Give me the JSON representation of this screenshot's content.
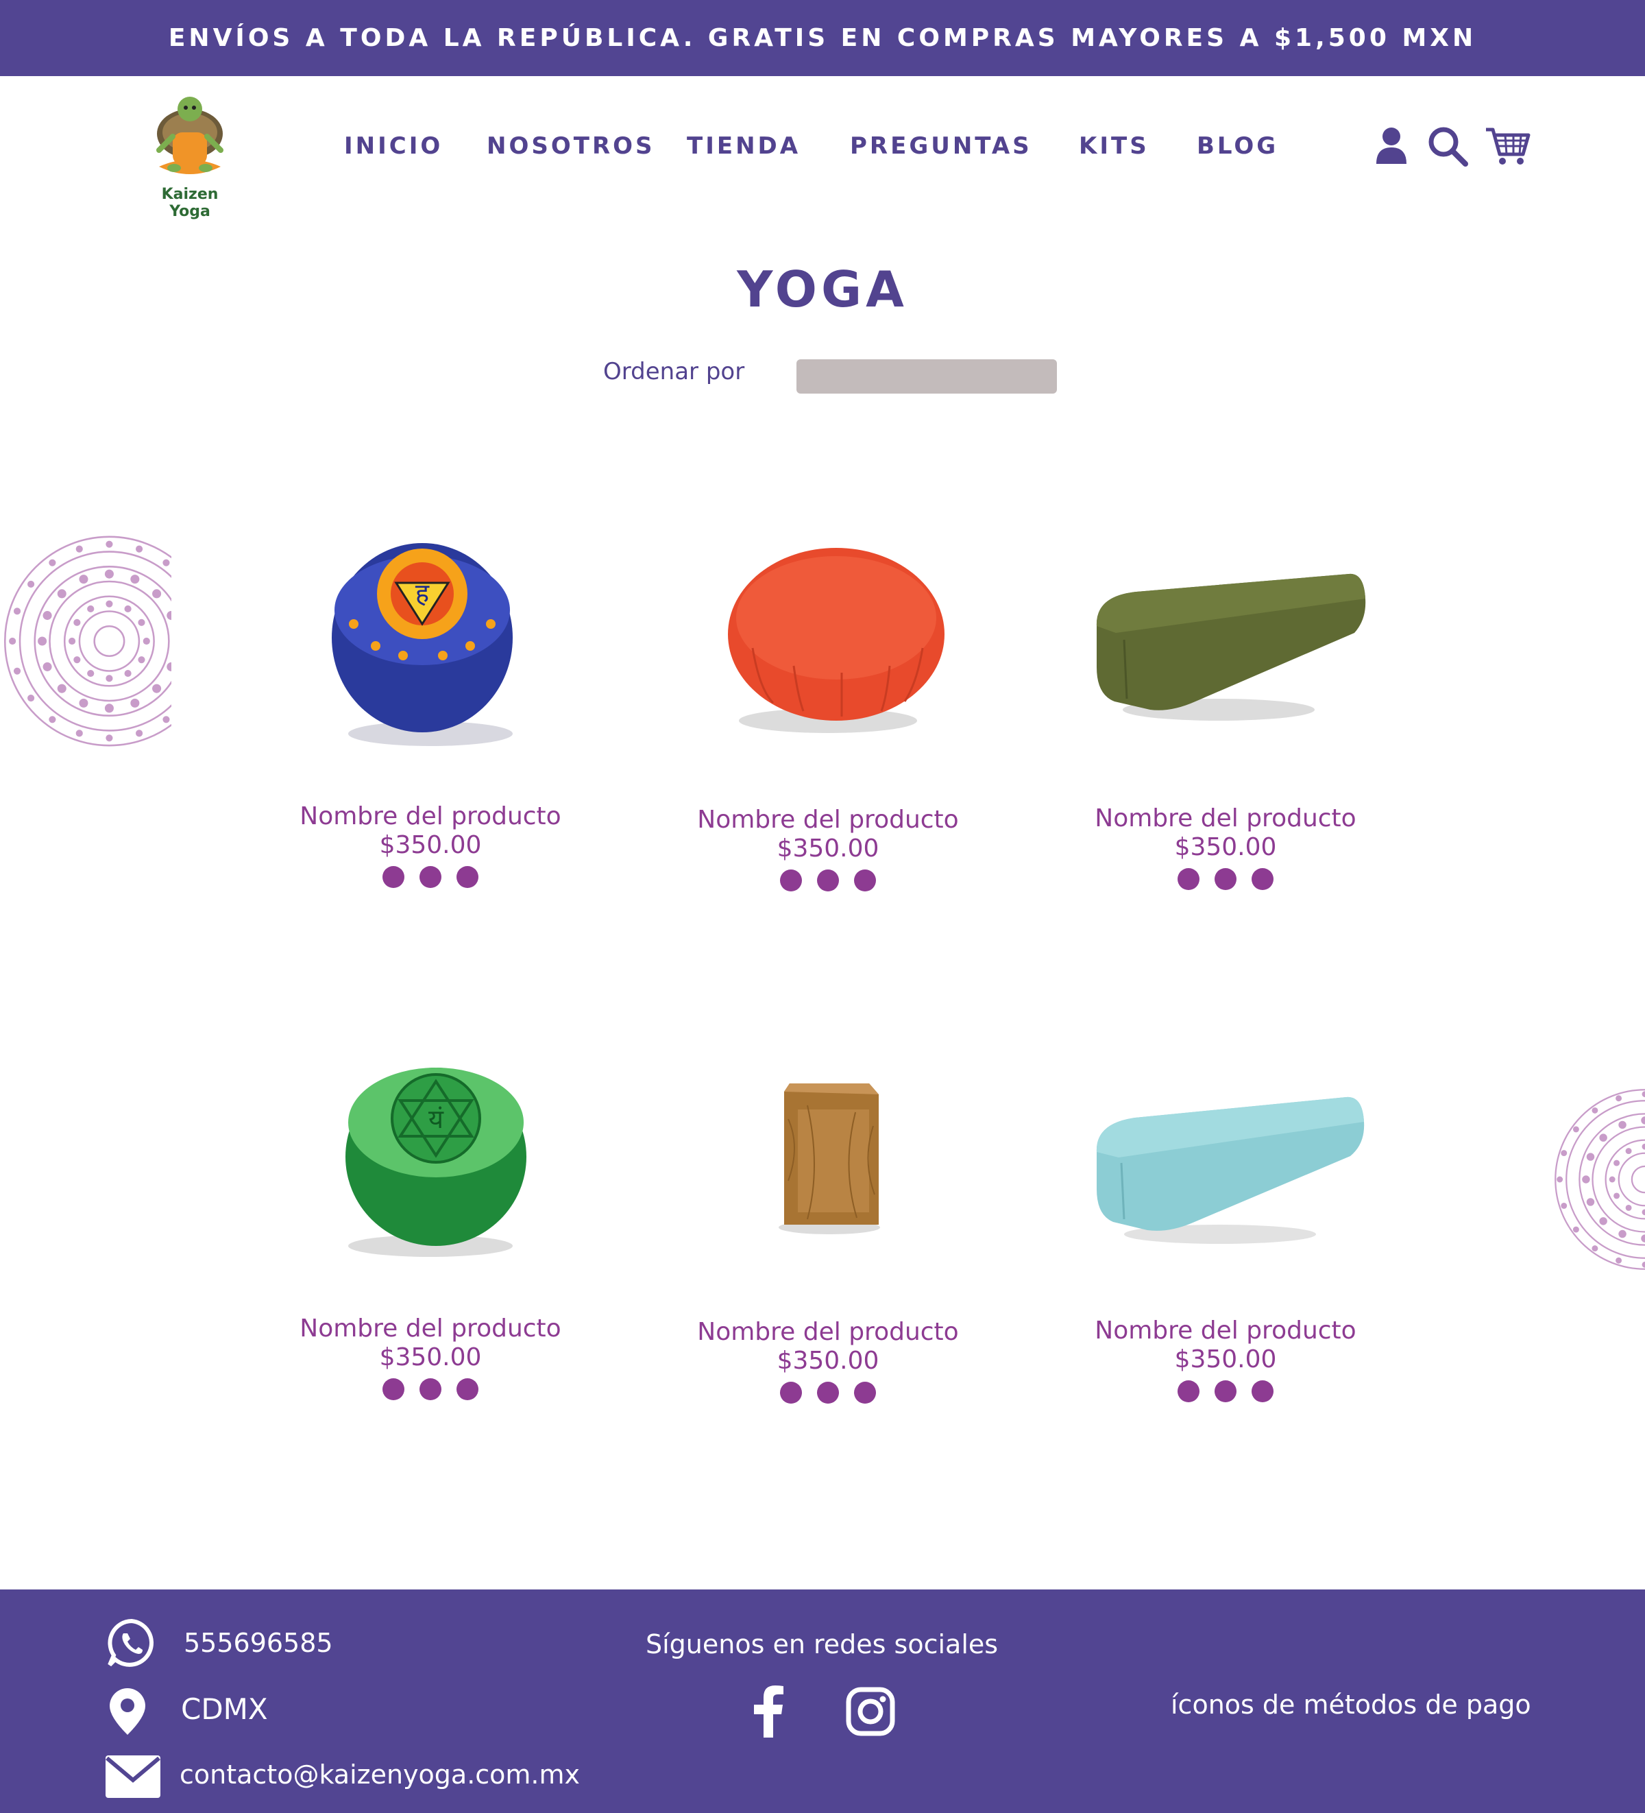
{
  "announcement": "ENVÍOS A TODA LA REPÚBLICA. GRATIS EN COMPRAS MAYORES A $1,500 MXN",
  "brand": {
    "logo_text": "Kaizen Yoga"
  },
  "nav": {
    "items": [
      {
        "label": "INICIO"
      },
      {
        "label": "NOSOTROS"
      },
      {
        "label": "TIENDA"
      },
      {
        "label": "PREGUNTAS"
      },
      {
        "label": "KITS"
      },
      {
        "label": "BLOG"
      }
    ],
    "icons": [
      "user-icon",
      "search-icon",
      "cart-icon"
    ]
  },
  "page": {
    "title": "YOGA",
    "sort_label": "Ordenar por",
    "sort_value": ""
  },
  "products": [
    {
      "name": "Nombre del producto",
      "price": "$350.00",
      "image": "blue-chakra-zafu-cushion"
    },
    {
      "name": "Nombre del producto",
      "price": "$350.00",
      "image": "red-zafu-cushion"
    },
    {
      "name": "Nombre del producto",
      "price": "$350.00",
      "image": "olive-green-bolster"
    },
    {
      "name": "Nombre del producto",
      "price": "$350.00",
      "image": "green-chakra-zafu-cushion"
    },
    {
      "name": "Nombre del producto",
      "price": "$350.00",
      "image": "wooden-yoga-block"
    },
    {
      "name": "Nombre del producto",
      "price": "$350.00",
      "image": "light-blue-bolster"
    }
  ],
  "footer": {
    "phone": "555696585",
    "location": "CDMX",
    "email": "contacto@kaizenyoga.com.mx",
    "social_heading": "Síguenos en redes sociales",
    "social_icons": [
      "facebook-icon",
      "instagram-icon"
    ],
    "payment_text": "íconos de métodos de pago"
  },
  "colors": {
    "primary": "#524592",
    "accent": "#8d3b92",
    "mandala": "#c89cc9",
    "sort_box": "#c3bbbb"
  }
}
